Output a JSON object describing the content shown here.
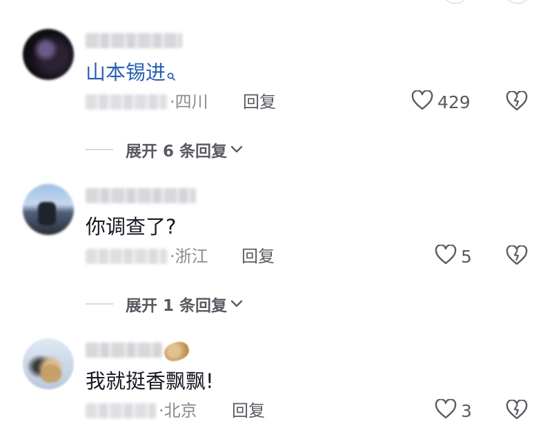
{
  "comments": [
    {
      "text_prefix": "",
      "mention": "山本锡进",
      "location": "四川",
      "reply_label": "回复",
      "likes": "429",
      "expand_label": "展开 6 条回复"
    },
    {
      "text": "你调查了?",
      "location": "浙江",
      "reply_label": "回复",
      "likes": "5",
      "expand_label": "展开 1 条回复"
    },
    {
      "text": "我就挺香飘飘!",
      "location": "北京",
      "reply_label": "回复",
      "likes": "3"
    }
  ],
  "meta_separator": "·",
  "icons": {
    "like": "heart-outline-icon",
    "dislike": "broken-heart-icon",
    "expand": "chevron-down-icon",
    "mention": "search-icon"
  },
  "colors": {
    "mention": "#2a5fb5",
    "text": "#161823",
    "muted": "#8a8b91"
  }
}
